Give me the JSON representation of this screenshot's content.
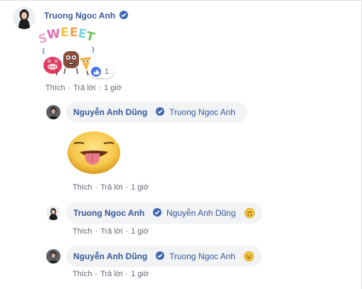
{
  "comments": [
    {
      "author": "Truong Ngoc Anh",
      "verified": true,
      "content_type": "sticker",
      "sticker": {
        "name": "sweeet-sticker",
        "text": "SWEEET"
      },
      "reaction": {
        "icon": "like-icon",
        "count": "1"
      },
      "actions": {
        "like": "Thích",
        "reply": "Trả lời",
        "time": "1 giờ"
      }
    }
  ],
  "replies": [
    {
      "author": "Nguyễn Anh Dũng",
      "verified": true,
      "mention": "Truong Ngoc Anh",
      "attachment": {
        "name": "tongue-out-sticker"
      },
      "actions": {
        "like": "Thích",
        "reply": "Trả lời",
        "time": "1 giờ"
      }
    },
    {
      "author": "Truong Ngoc Anh",
      "verified": true,
      "mention": "Nguyễn Anh Dũng",
      "emoji": "upside-down-face-emoji",
      "actions": {
        "like": "Thích",
        "reply": "Trả lời",
        "time": "1 giờ"
      }
    },
    {
      "author": "Nguyễn Anh Dũng",
      "verified": true,
      "mention": "Truong Ngoc Anh",
      "emoji": "tongue-wink-emoji",
      "actions": {
        "like": "Thích",
        "reply": "Trả lời",
        "time": "1 giờ"
      }
    }
  ],
  "colors": {
    "name_link": "#385898",
    "meta_text": "#606770",
    "bubble_bg": "#f2f3f5",
    "verified_badge": "#4267b2",
    "like_blue": "#4a76e8"
  }
}
